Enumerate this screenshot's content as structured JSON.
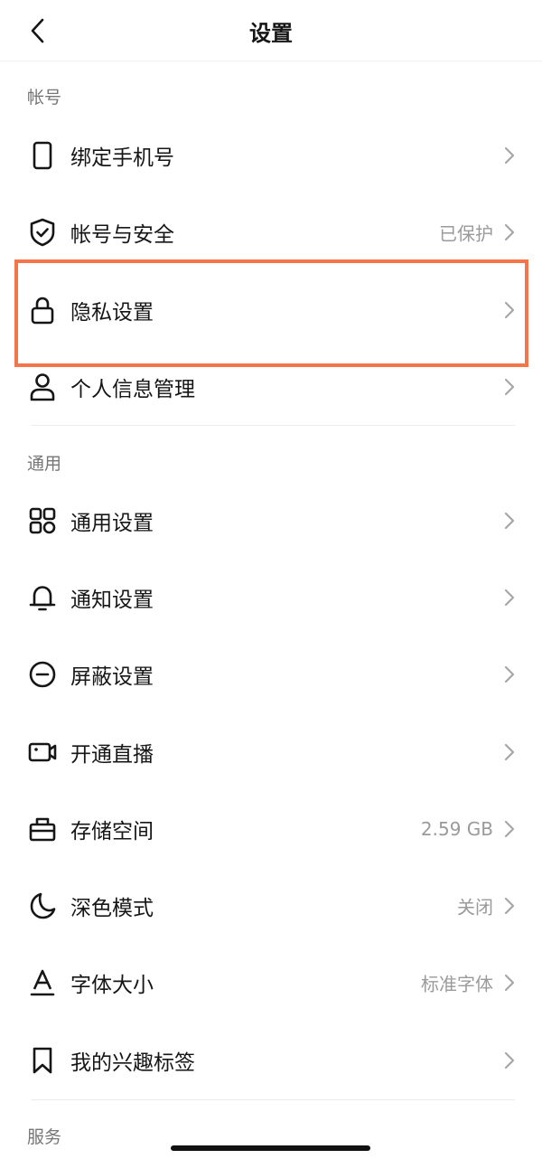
{
  "header": {
    "title": "设置",
    "back_icon": "chevron-left-icon"
  },
  "sections": {
    "account": {
      "label": "帐号"
    },
    "general": {
      "label": "通用"
    },
    "service": {
      "label": "服务"
    }
  },
  "account_items": [
    {
      "label": "绑定手机号",
      "icon": "phone-icon",
      "value": ""
    },
    {
      "label": "帐号与安全",
      "icon": "shield-check-icon",
      "value": "已保护"
    },
    {
      "label": "隐私设置",
      "icon": "lock-icon",
      "value": ""
    },
    {
      "label": "个人信息管理",
      "icon": "person-icon",
      "value": ""
    }
  ],
  "general_items": [
    {
      "label": "通用设置",
      "icon": "grid-icon",
      "value": ""
    },
    {
      "label": "通知设置",
      "icon": "bell-icon",
      "value": ""
    },
    {
      "label": "屏蔽设置",
      "icon": "block-icon",
      "value": ""
    },
    {
      "label": "开通直播",
      "icon": "video-camera-icon",
      "value": ""
    },
    {
      "label": "存储空间",
      "icon": "storage-box-icon",
      "value": "2.59 GB"
    },
    {
      "label": "深色模式",
      "icon": "moon-icon",
      "value": "关闭"
    },
    {
      "label": "字体大小",
      "icon": "font-size-icon",
      "value": "标准字体"
    },
    {
      "label": "我的兴趣标签",
      "icon": "bookmark-icon",
      "value": ""
    }
  ],
  "colors": {
    "highlight": "#f2764a",
    "text": "#161616",
    "secondary": "#9a9a9a",
    "section": "#767676"
  }
}
